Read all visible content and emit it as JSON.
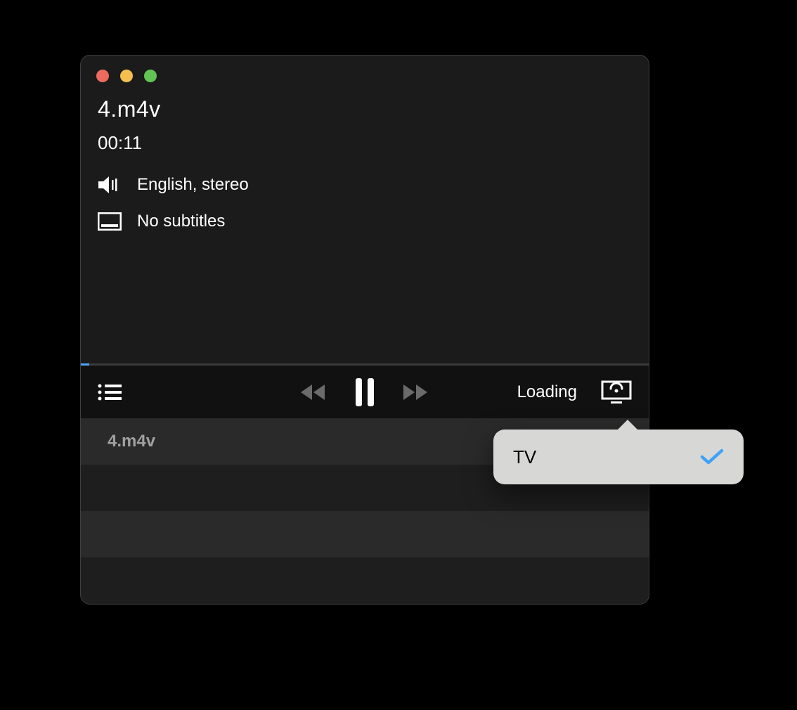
{
  "file": {
    "title": "4.m4v",
    "elapsed": "00:11"
  },
  "audio": {
    "label": "English, stereo"
  },
  "subtitles": {
    "label": "No subtitles"
  },
  "controls": {
    "status": "Loading"
  },
  "playlist": {
    "items": [
      {
        "label": "4.m4v"
      },
      {
        "label": ""
      },
      {
        "label": ""
      },
      {
        "label": ""
      }
    ]
  },
  "cast_popover": {
    "items": [
      {
        "label": "TV",
        "selected": true
      }
    ]
  },
  "colors": {
    "accent": "#4da3ff",
    "check": "#3fa2f7"
  }
}
